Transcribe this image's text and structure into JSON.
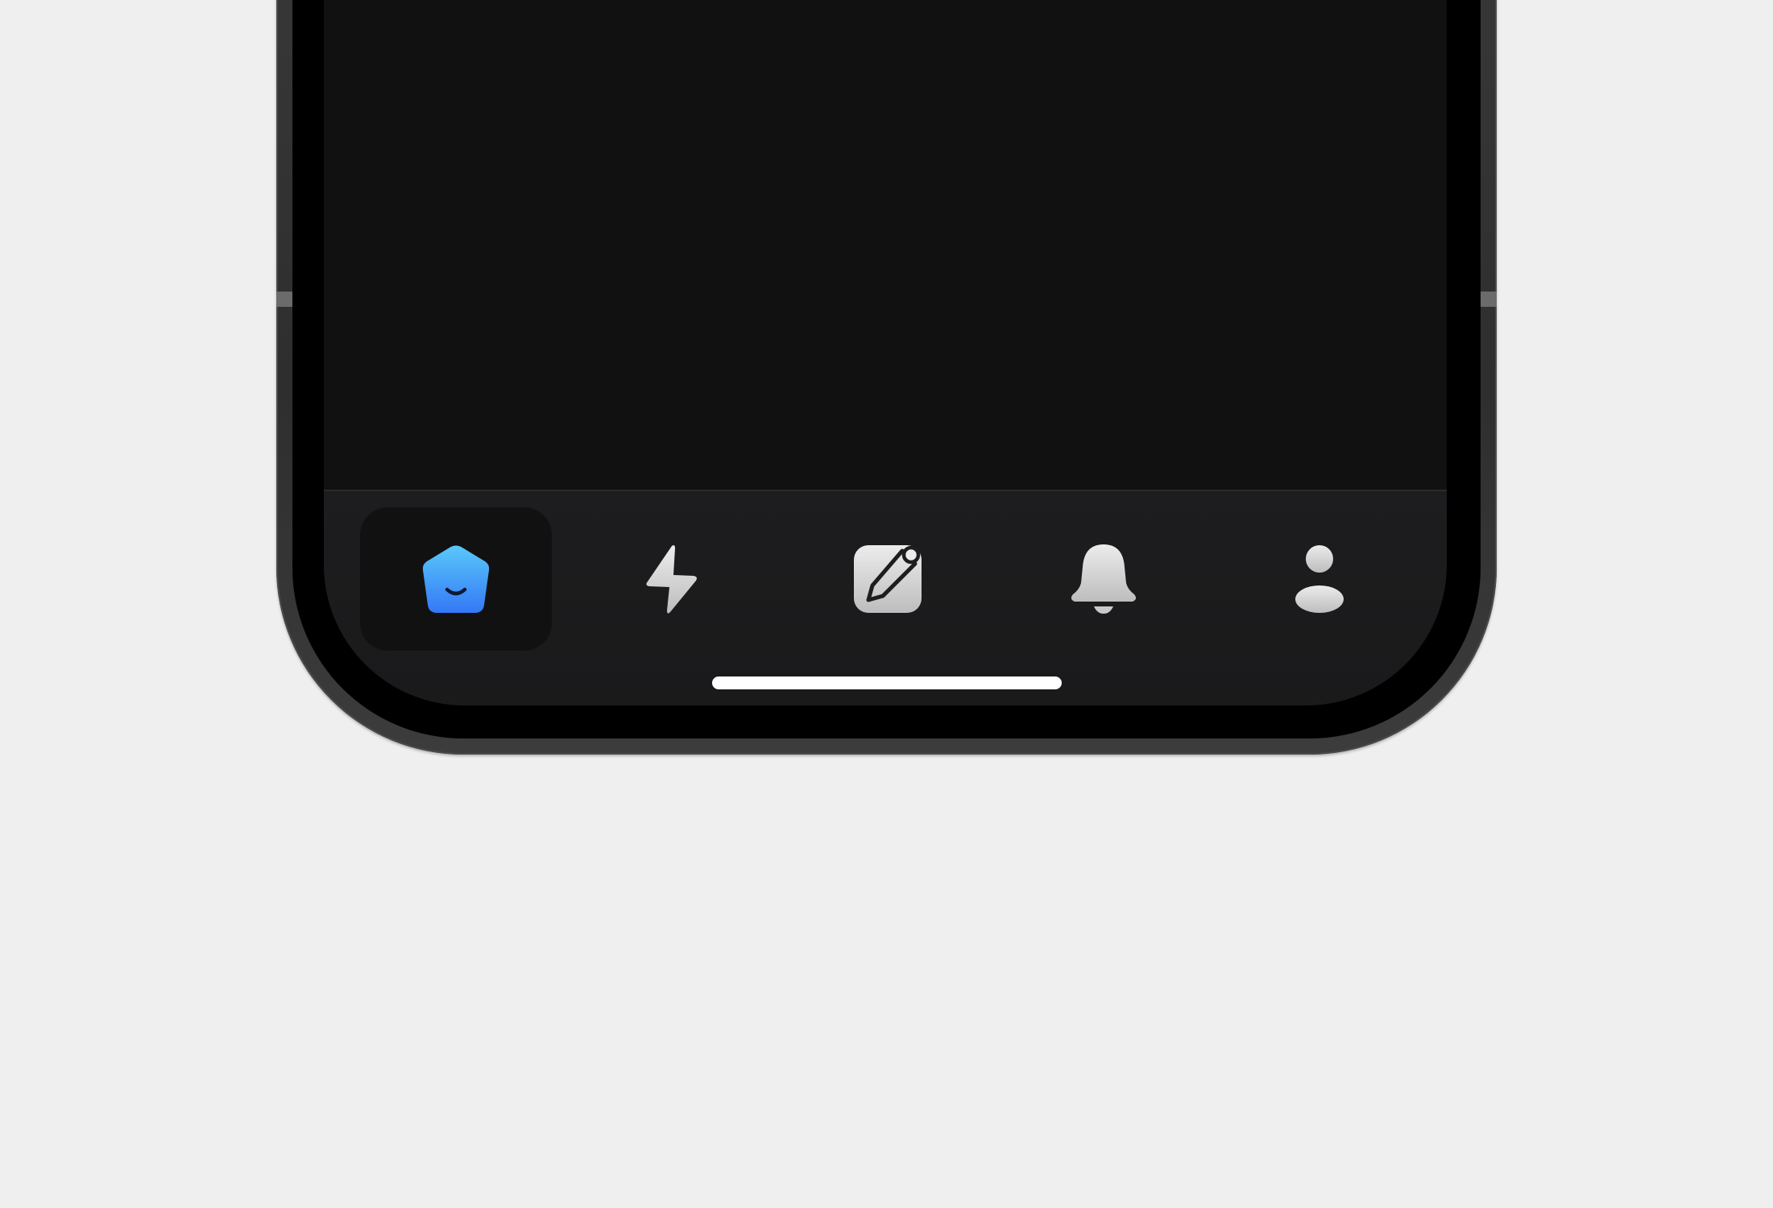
{
  "theme": {
    "page_background": "#efefef",
    "screen_background": "#111111",
    "tab_bar_background": "#1c1c1d",
    "active_accent_top": "#5ac8fa",
    "active_accent_bottom": "#3478f6",
    "inactive_icon": "#d9d9d9"
  },
  "tab_bar": {
    "selected_index": 0,
    "tabs": [
      {
        "id": "home",
        "icon": "home-icon",
        "selected": true
      },
      {
        "id": "activity",
        "icon": "lightning-icon",
        "selected": false
      },
      {
        "id": "compose",
        "icon": "compose-icon",
        "selected": false
      },
      {
        "id": "notifications",
        "icon": "bell-icon",
        "selected": false
      },
      {
        "id": "profile",
        "icon": "person-icon",
        "selected": false
      }
    ]
  }
}
